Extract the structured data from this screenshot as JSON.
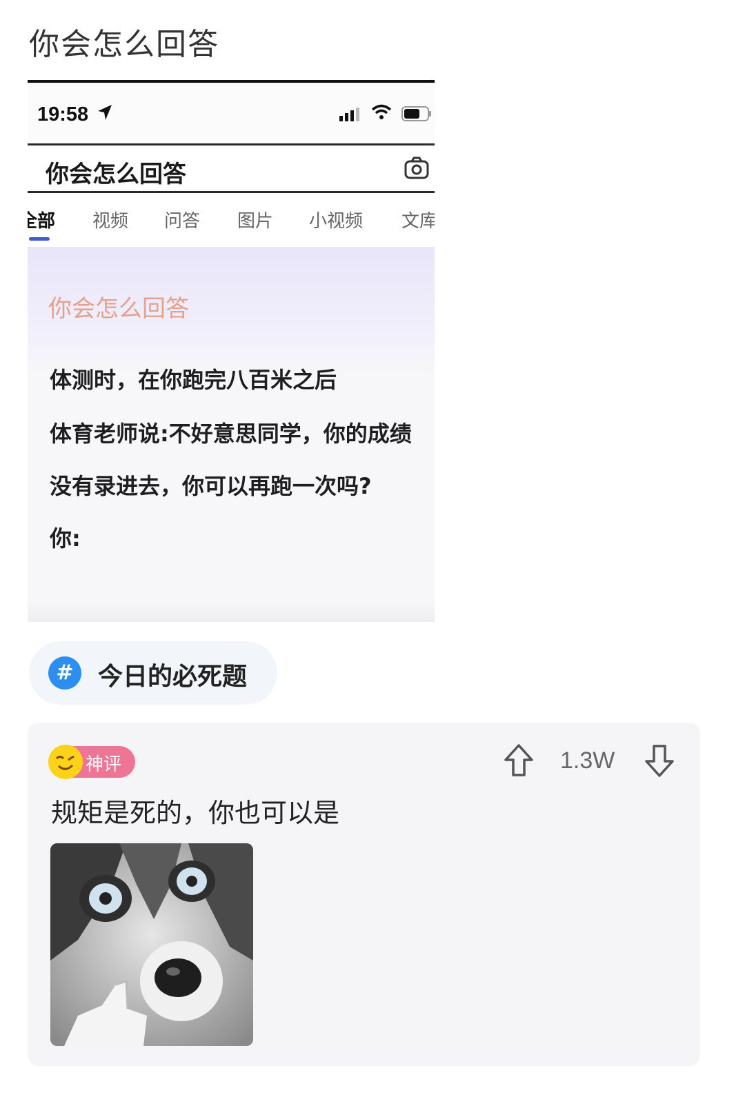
{
  "post": {
    "title": "你会怎么回答"
  },
  "screenshot": {
    "status_bar": {
      "time": "19:58"
    },
    "search": {
      "query": "你会怎么回答"
    },
    "tabs": [
      {
        "label": "全部",
        "active": true
      },
      {
        "label": "视频",
        "active": false
      },
      {
        "label": "问答",
        "active": false
      },
      {
        "label": "图片",
        "active": false
      },
      {
        "label": "小视频",
        "active": false
      },
      {
        "label": "文库",
        "active": false
      }
    ],
    "question": {
      "title": "你会怎么回答",
      "lines": [
        "体测时，在你跑完八百米之后",
        "体育老师说:不好意思同学，你的成绩",
        "没有录进去，你可以再跑一次吗?",
        "你:"
      ]
    }
  },
  "topic": {
    "icon": "#",
    "label": "今日的必死题"
  },
  "comment": {
    "badge": "神评",
    "votes": "1.3W",
    "text": "规矩是死的，你也可以是",
    "image": "husky-pointing-meme"
  },
  "colors": {
    "accent": "#3f5bd6",
    "topic_icon": "#2c8ff0",
    "badge": "#ee7595",
    "question_title": "#e4a18f"
  }
}
